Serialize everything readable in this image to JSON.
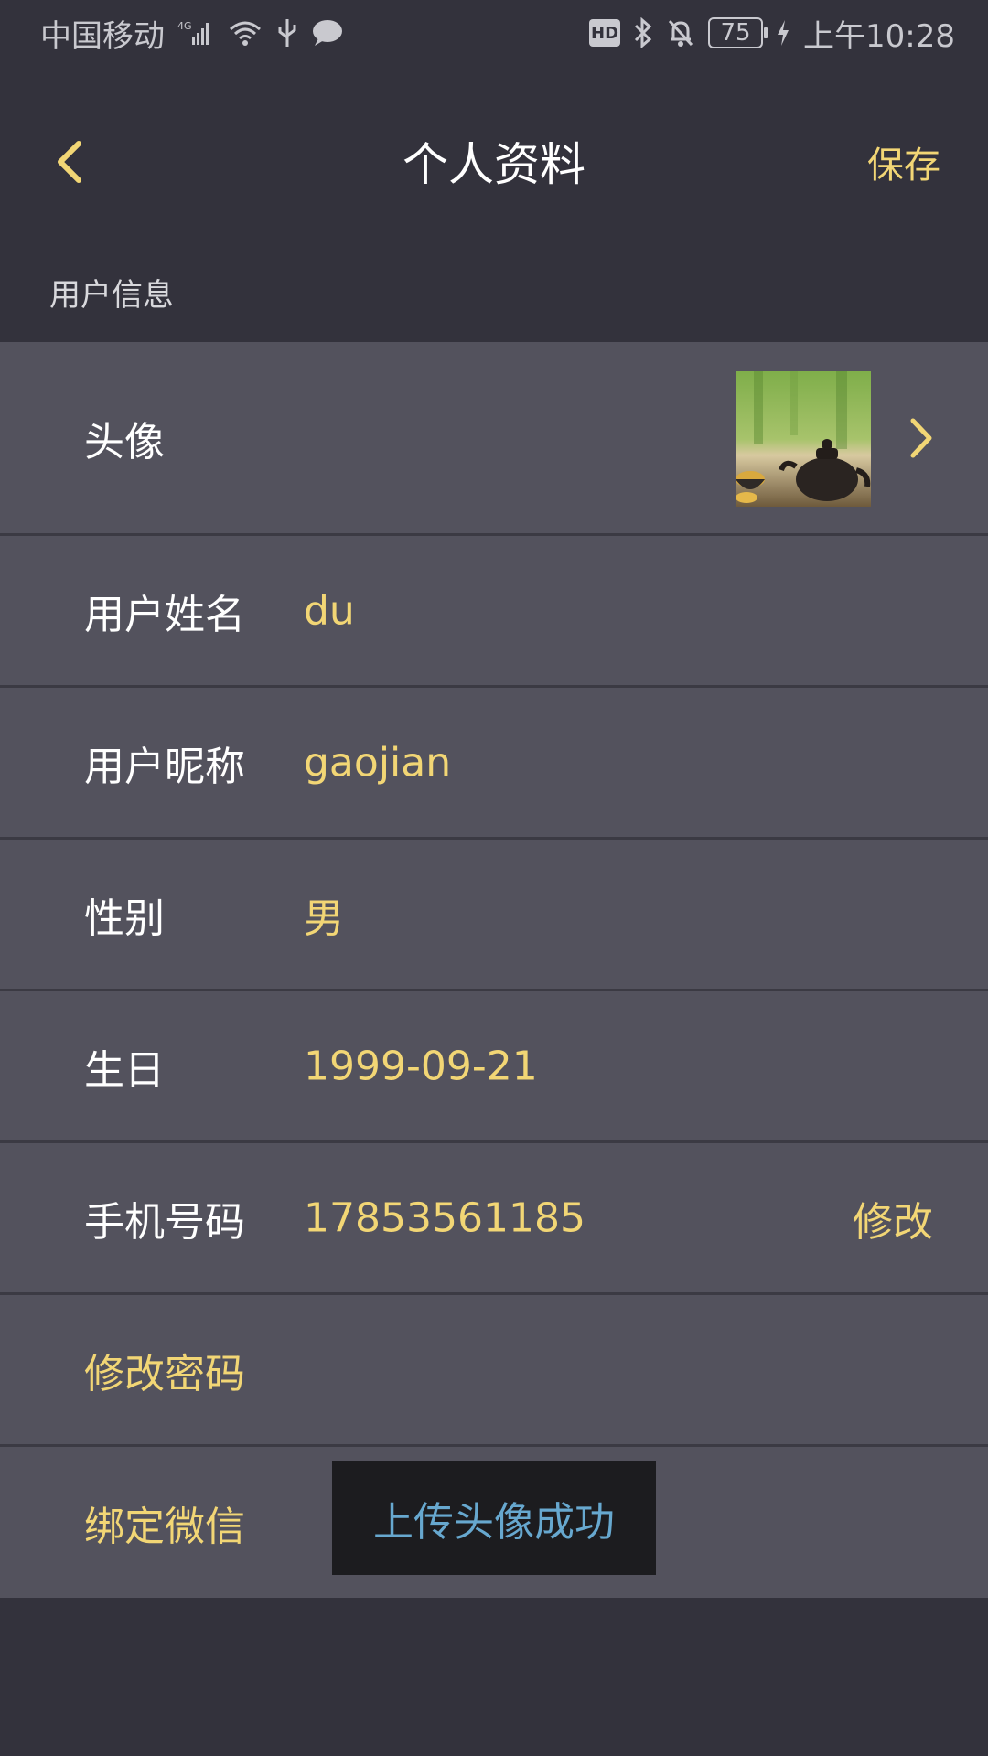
{
  "status_bar": {
    "carrier": "中国移动",
    "network": "4G",
    "battery": "75",
    "time": "上午10:28",
    "hd": "HD"
  },
  "nav": {
    "title": "个人资料",
    "save_label": "保存"
  },
  "section": {
    "title": "用户信息"
  },
  "profile": {
    "avatar_label": "头像",
    "username_label": "用户姓名",
    "username_value": "du",
    "nickname_label": "用户昵称",
    "nickname_value": "gaojian",
    "gender_label": "性别",
    "gender_value": "男",
    "birthday_label": "生日",
    "birthday_value": "1999-09-21",
    "phone_label": "手机号码",
    "phone_value": "17853561185",
    "phone_action": "修改",
    "password_label": "修改密码",
    "wechat_label": "绑定微信"
  },
  "toast": {
    "message": "上传头像成功"
  },
  "colors": {
    "background": "#33323c",
    "row_bg": "#53525d",
    "accent": "#f2d675",
    "toast_text": "#67a8cf"
  }
}
